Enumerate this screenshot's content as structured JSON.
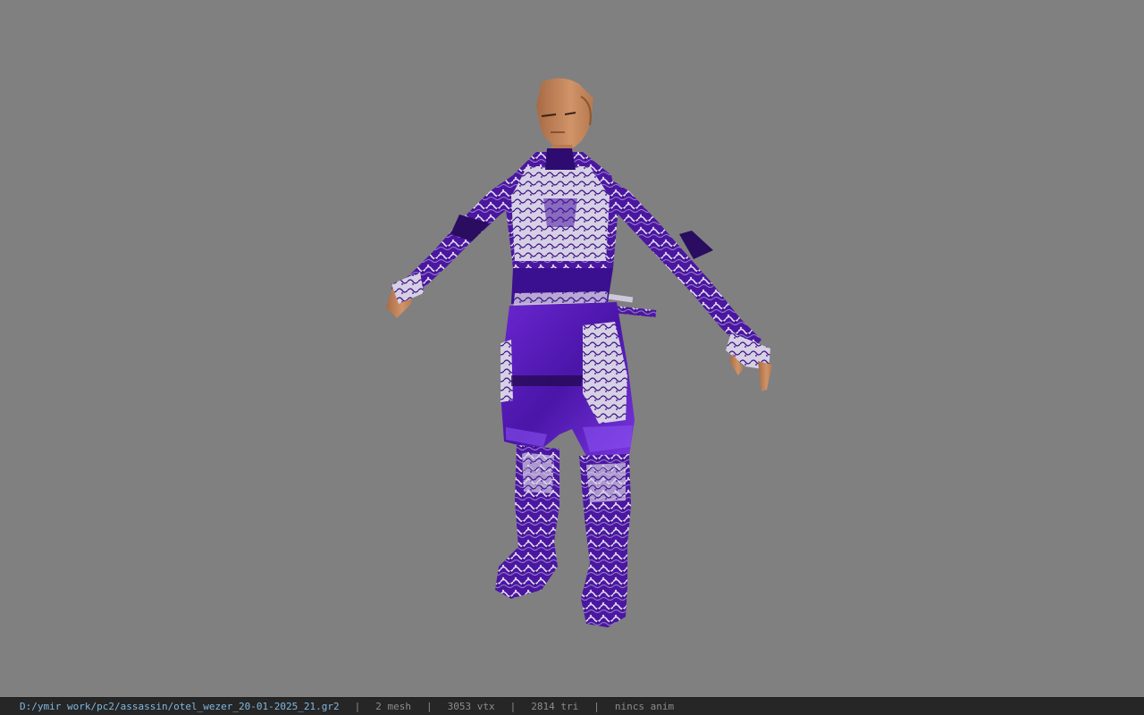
{
  "viewport": {
    "background_color": "#808080",
    "model": {
      "name": "assassin character model",
      "armor_color": "#5a1fb0",
      "armor_highlight": "#e8e4f0",
      "skin_color": "#c98a5e"
    }
  },
  "status_bar": {
    "file_path": "D:/ymir work/pc2/assassin/otel_wezer_20-01-2025_21.gr2",
    "separator": "|",
    "mesh_count": "2 mesh",
    "vertex_count": "3053 vtx",
    "triangle_count": "2814 tri",
    "animation_status": "nincs anim",
    "path_color": "#7fb8e0",
    "text_color": "#8c8c8c"
  }
}
